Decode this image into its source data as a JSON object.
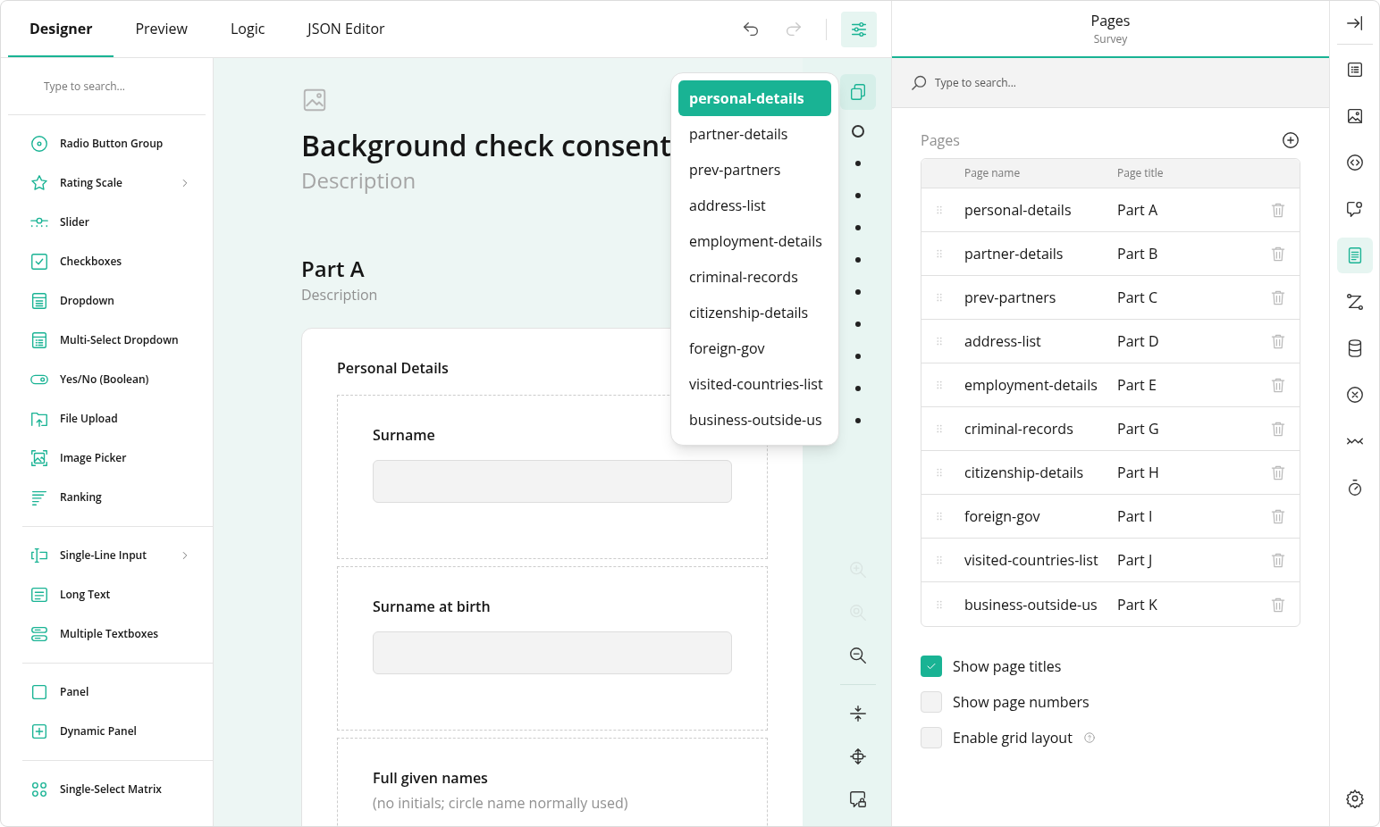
{
  "top_tabs": [
    {
      "label": "Designer",
      "selected": true
    },
    {
      "label": "Preview",
      "selected": false
    },
    {
      "label": "Logic",
      "selected": false
    },
    {
      "label": "JSON Editor",
      "selected": false
    }
  ],
  "top_actions": [
    {
      "disabled": false,
      "selected": false
    },
    {
      "disabled": true,
      "selected": false
    },
    {
      "disabled": false,
      "selected": true
    }
  ],
  "toolbox": {
    "search_placeholder": "Type to search...",
    "groups": [
      [
        {
          "label": "Radio Button Group",
          "has_submenu": false
        },
        {
          "label": "Rating Scale",
          "has_submenu": true
        },
        {
          "label": "Slider",
          "has_submenu": false
        },
        {
          "label": "Checkboxes",
          "has_submenu": false
        },
        {
          "label": "Dropdown",
          "has_submenu": false
        },
        {
          "label": "Multi-Select Dropdown",
          "has_submenu": false
        },
        {
          "label": "Yes/No (Boolean)",
          "has_submenu": false
        },
        {
          "label": "File Upload",
          "has_submenu": false
        },
        {
          "label": "Image Picker",
          "has_submenu": false
        },
        {
          "label": "Ranking",
          "has_submenu": false
        }
      ],
      [
        {
          "label": "Single-Line Input",
          "has_submenu": true
        },
        {
          "label": "Long Text",
          "has_submenu": false
        },
        {
          "label": "Multiple Textboxes",
          "has_submenu": false
        }
      ],
      [
        {
          "label": "Panel",
          "has_submenu": false
        },
        {
          "label": "Dynamic Panel",
          "has_submenu": false
        }
      ],
      [
        {
          "label": "Single-Select Matrix",
          "has_submenu": false
        }
      ]
    ]
  },
  "survey": {
    "title": "Background check consent",
    "description": "Description",
    "page_title": "Part A",
    "page_description": "Description",
    "panel": {
      "title": "Personal Details",
      "questions": [
        {
          "title": "Surname",
          "has_input": true
        },
        {
          "title": "Surname at birth",
          "has_input": true
        },
        {
          "title": "Full given names",
          "description": "(no initials; circle name normally used)"
        }
      ]
    }
  },
  "page_list_popup": [
    {
      "label": "personal-details",
      "selected": true
    },
    {
      "label": "partner-details",
      "selected": false
    },
    {
      "label": "prev-partners",
      "selected": false
    },
    {
      "label": "address-list",
      "selected": false
    },
    {
      "label": "employment-details",
      "selected": false
    },
    {
      "label": "criminal-records",
      "selected": false
    },
    {
      "label": "citizenship-details",
      "selected": false
    },
    {
      "label": "foreign-gov",
      "selected": false
    },
    {
      "label": "visited-countries-list",
      "selected": false
    },
    {
      "label": "business-outside-us",
      "selected": false
    }
  ],
  "page_navigator": [
    {
      "selected": true
    },
    {
      "selected": false
    },
    {
      "selected": false
    },
    {
      "selected": false
    },
    {
      "selected": false
    },
    {
      "selected": false
    },
    {
      "selected": false
    },
    {
      "selected": false
    },
    {
      "selected": false
    },
    {
      "selected": false
    }
  ],
  "canvas_tools": [
    {
      "disabled": true
    },
    {
      "disabled": true
    },
    {
      "disabled": false
    },
    {
      "disabled": false
    },
    {
      "disabled": false
    },
    {
      "disabled": false
    }
  ],
  "property_grid": {
    "title": "Pages",
    "subtitle": "Survey",
    "search_placeholder": "Type to search...",
    "section_title": "Pages",
    "columns": [
      "Page name",
      "Page title"
    ],
    "rows": [
      {
        "name": "personal-details",
        "title": "Part A"
      },
      {
        "name": "partner-details",
        "title": "Part B"
      },
      {
        "name": "prev-partners",
        "title": "Part C"
      },
      {
        "name": "address-list",
        "title": "Part D"
      },
      {
        "name": "employment-details",
        "title": "Part E"
      },
      {
        "name": "criminal-records",
        "title": "Part G"
      },
      {
        "name": "citizenship-details",
        "title": "Part H"
      },
      {
        "name": "foreign-gov",
        "title": "Part I"
      },
      {
        "name": "visited-countries-list",
        "title": "Part J"
      },
      {
        "name": "business-outside-us",
        "title": "Part K"
      }
    ],
    "options": [
      {
        "label": "Show page titles",
        "checked": true
      },
      {
        "label": "Show page numbers",
        "checked": false
      },
      {
        "label": "Enable grid layout",
        "checked": false,
        "has_help": true
      }
    ]
  },
  "side_tabs": [
    {
      "selected": false
    },
    {
      "selected": false
    },
    {
      "selected": false
    },
    {
      "selected": false
    },
    {
      "selected": true
    },
    {
      "selected": false
    },
    {
      "selected": false
    },
    {
      "selected": false
    },
    {
      "selected": false
    },
    {
      "selected": false
    }
  ]
}
